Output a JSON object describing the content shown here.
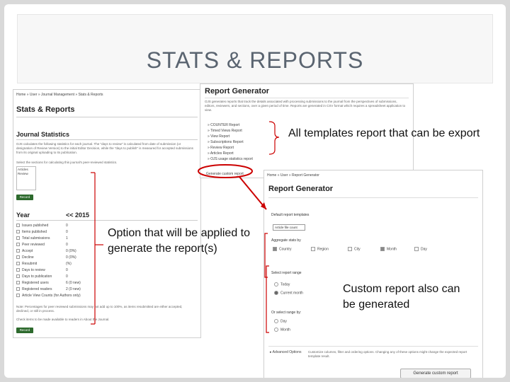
{
  "slide": {
    "title": "STATS & REPORTS"
  },
  "left_screenshot": {
    "breadcrumb": "Home » User » Journal Management » Stats & Reports",
    "heading": "Stats & Reports",
    "section_heading": "Journal Statistics",
    "description": "OJS calculates the following statistics for each journal. The \"days to review\" is calculated from date of submission (or designation of Review Version) to the initial Editor Decision, while the \"days to publish\" is measured for accepted submissions from its original uploading to its publication.",
    "select_prompt": "Select the sections for calculating this journal's peer-reviewed statistics.",
    "section_options": [
      "Articles",
      "Review"
    ],
    "record_button": "Record",
    "year_label": "Year",
    "year_nav": "<< 2015",
    "rows": [
      {
        "label": "Issues published",
        "value": "0"
      },
      {
        "label": "Items published",
        "value": "0"
      },
      {
        "label": "Total submissions",
        "value": "1"
      },
      {
        "label": "Peer reviewed",
        "value": "0"
      },
      {
        "label": "Accept",
        "value": "0 (0%)"
      },
      {
        "label": "Decline",
        "value": "0 (0%)"
      },
      {
        "label": "Resubmit",
        "value": "(%)"
      },
      {
        "label": "Days to review",
        "value": "0"
      },
      {
        "label": "Days to publication",
        "value": "0"
      },
      {
        "label": "Registered users",
        "value": "6 (0 new)"
      },
      {
        "label": "Registered readers",
        "value": "2 (0 new)"
      },
      {
        "label": "Article View Counts (for Authors only)",
        "value": ""
      }
    ],
    "note": "Note: Percentages for peer reviewed submissions may not add up to 100%, as items resubmitted are either accepted, declined, or still in process.",
    "check_note": "Check items to be made available to readers in About the Journal.",
    "record_button_2": "Record"
  },
  "top_screenshot": {
    "heading": "Report Generator",
    "description": "OJS generates reports that track the details associated with processing submissions to the journal from the perspectives of submissions, editors, reviewers, and sections, over a given period of time. Reports are generated in CSV format which requires a spreadsheet application to view.",
    "reports": [
      "» COUNTER Report",
      "» Timed Views Report",
      "» View Report",
      "» Subscriptions Report",
      "» Review Report",
      "» Articles Report",
      "» OJS usage statistics report"
    ],
    "custom_link": "Generate custom report"
  },
  "bottom_screenshot": {
    "breadcrumb": "Home » User » Report Generator",
    "heading": "Report Generator",
    "default_templates_label": "Default report templates",
    "template_select": "Article file count",
    "aggregate_label": "Aggregate stats by",
    "aggregate_options": [
      {
        "label": "Country",
        "checked": true
      },
      {
        "label": "Region",
        "checked": false
      },
      {
        "label": "City",
        "checked": false
      },
      {
        "label": "Month",
        "checked": true
      },
      {
        "label": "Day",
        "checked": false
      }
    ],
    "select_range_label": "Select report range",
    "range_options": [
      {
        "label": "Today",
        "checked": false
      },
      {
        "label": "Current month",
        "checked": true
      }
    ],
    "select_range_by_label": "Or select range by:",
    "range_by_options": [
      {
        "label": "Day",
        "checked": false
      },
      {
        "label": "Month",
        "checked": false
      }
    ],
    "advanced_label": "Advanced Options",
    "advanced_desc": "Customize columns, filter and ordering options. Changing any of these options might change the expected report template result.",
    "generate_button": "Generate custom report"
  },
  "callouts": {
    "templates": "All templates report that can be export",
    "options": "Option that will be applied to generate the report(s)",
    "custom": "Custom report also can be generated"
  },
  "colors": {
    "title": "#5a6470",
    "annotation": "#cc0000",
    "button_green": "#2d6a2d"
  }
}
